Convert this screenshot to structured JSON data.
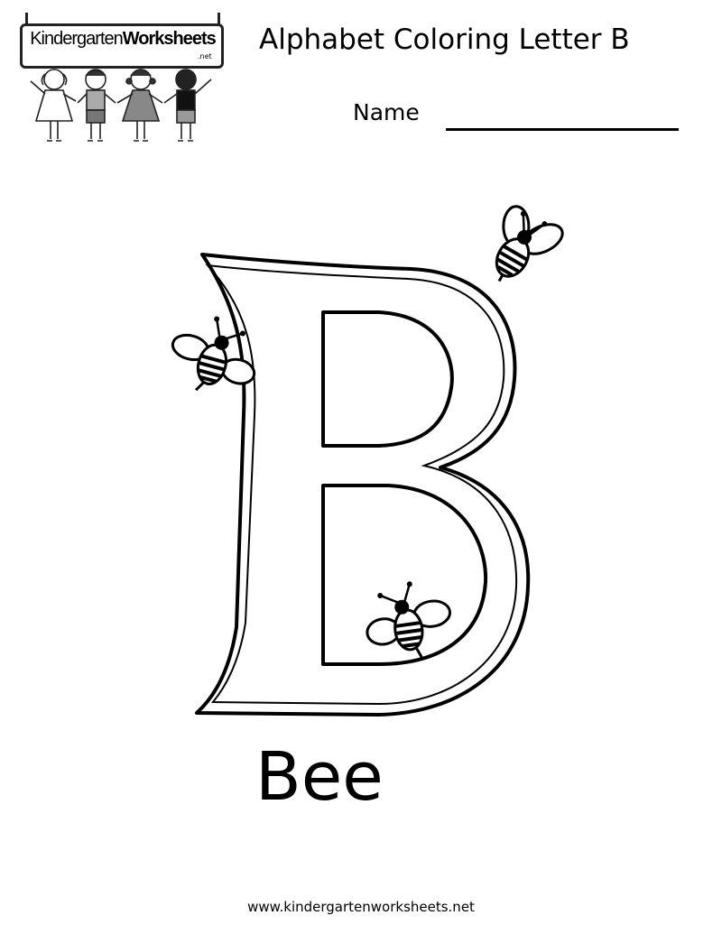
{
  "logo": {
    "name_part1": "Kindergarten",
    "name_part2": "Worksheets",
    "suffix": ".net"
  },
  "worksheet": {
    "title": "Alphabet Coloring Letter B",
    "name_label": "Name",
    "letter": "B",
    "word": "Bee",
    "icons": [
      "bee-icon",
      "bee-icon",
      "bee-icon"
    ]
  },
  "footer": {
    "url": "www.kindergartenworksheets.net"
  }
}
